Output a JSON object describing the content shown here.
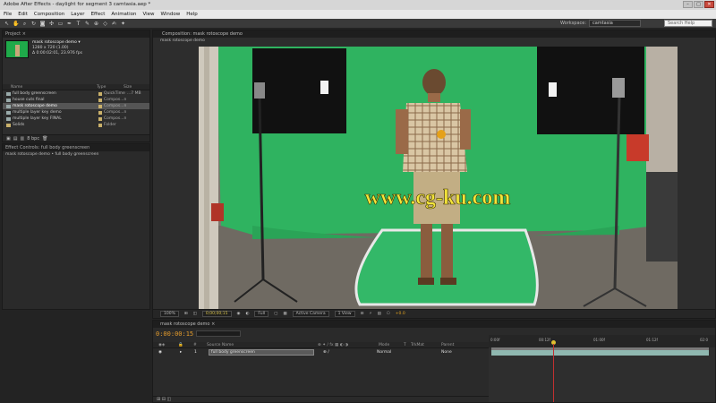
{
  "window": {
    "title": "Adobe After Effects - daylight for segment 3 camtasia.aep *",
    "buttons": [
      "–",
      "□",
      "✕"
    ]
  },
  "menu": [
    "File",
    "Edit",
    "Composition",
    "Layer",
    "Effect",
    "Animation",
    "View",
    "Window",
    "Help"
  ],
  "toolbar": {
    "tools": [
      "arrow-tool-icon",
      "hand-tool-icon",
      "zoom-tool-icon",
      "rotate-tool-icon",
      "camera-tool-icon",
      "pan-behind-tool-icon",
      "rectangle-tool-icon",
      "pen-tool-icon",
      "text-tool-icon",
      "brush-tool-icon",
      "clone-tool-icon",
      "eraser-tool-icon",
      "roto-brush-tool-icon",
      "puppet-tool-icon"
    ],
    "tool_glyphs": [
      "↖",
      "✋",
      "⌕",
      "↻",
      "◙",
      "✣",
      "▭",
      "✒",
      "T",
      "✎",
      "⊕",
      "◇",
      "✍",
      "✦"
    ],
    "workspace_label": "Workspace:",
    "workspace_value": "camtasia",
    "search_placeholder": "Search Help"
  },
  "project": {
    "tab": "Project ×",
    "comp_name": "mask rotoscope demo ▾",
    "comp_size": "1280 x 720 (1.00)",
    "comp_duration": "Δ 0:00:02:01, 23.976 fps",
    "columns": [
      "Name",
      "Type",
      "Size"
    ],
    "items": [
      {
        "name": "full body greenscreen",
        "type": "QuickTime",
        "size": "...7 MB",
        "folder": false,
        "selected": false
      },
      {
        "name": "house cuts final",
        "type": "Compos...n",
        "size": "",
        "folder": false,
        "selected": false
      },
      {
        "name": "mask rotoscope demo",
        "type": "Compos...n",
        "size": "",
        "folder": false,
        "selected": true
      },
      {
        "name": "multiple layer key demo",
        "type": "Compos...n",
        "size": "",
        "folder": false,
        "selected": false
      },
      {
        "name": "multiple layer key FINAL",
        "type": "Compos...n",
        "size": "",
        "folder": false,
        "selected": false
      },
      {
        "name": "Solids",
        "type": "Folder",
        "size": "",
        "folder": true,
        "selected": false
      }
    ],
    "bottom_bpc": "8 bpc"
  },
  "effect_controls": {
    "tab": "Effect Controls: full body greenscreen",
    "subtitle": "mask rotoscope demo • full body greenscreen"
  },
  "composition": {
    "tab": "Composition: mask rotoscope demo",
    "subtab": "mask rotoscope demo",
    "watermark": "www.cg-ku.com",
    "viewer_bar": {
      "zoom": "100%",
      "timecode": "0;00;00;15",
      "resolution": "Full",
      "camera": "Active Camera",
      "view": "1 View",
      "offset": "+0.0"
    }
  },
  "timeline": {
    "tab": "mask rotoscope demo ×",
    "current_time": "0:00:00:15",
    "columns": [
      "#",
      "Source Name",
      "Mode",
      "T",
      "TrkMat",
      "Parent"
    ],
    "layer": {
      "index": "1",
      "name": "full body greenscreen",
      "mode": "Normal",
      "trkmat": "",
      "parent": "None"
    },
    "ruler_labels": [
      "0:00f",
      "00:12f",
      "01:00f",
      "01:12f",
      "02:0"
    ],
    "playhead_fraction": 0.28
  },
  "colors": {
    "greenscreen": "#2fb360",
    "accent_time": "#e39b2c",
    "layer_bar": "#8fb8b0",
    "playhead": "#c03030"
  }
}
